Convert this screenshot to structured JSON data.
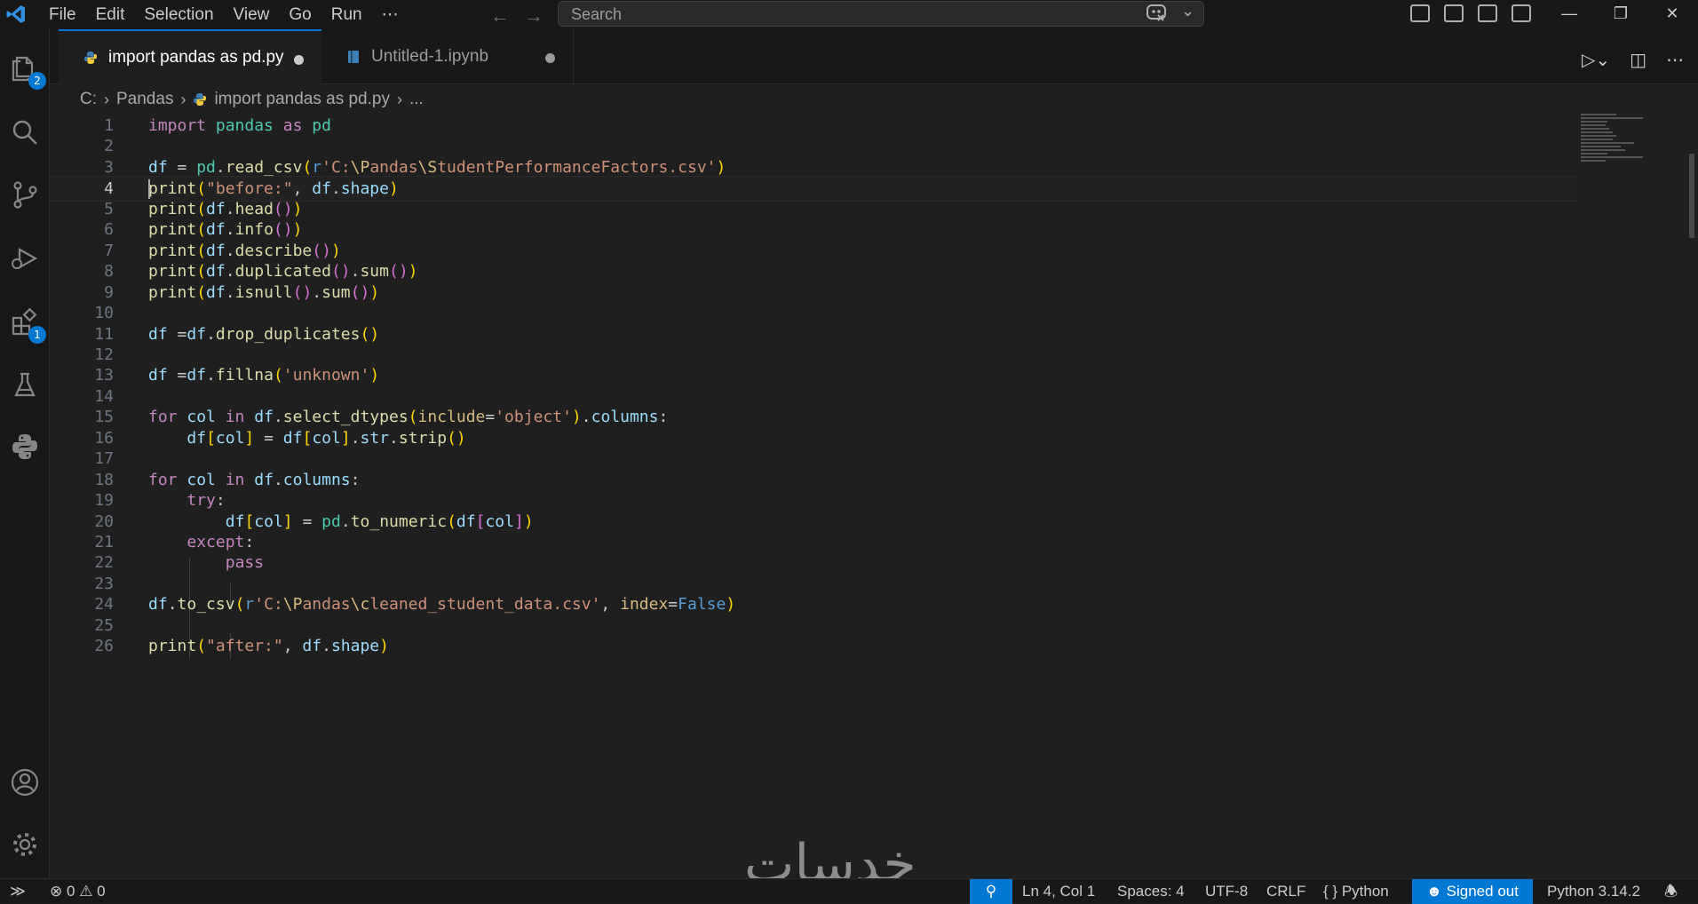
{
  "menu": [
    "File",
    "Edit",
    "Selection",
    "View",
    "Go",
    "Run",
    "⋯"
  ],
  "search": {
    "placeholder": "Search"
  },
  "activity_badges": {
    "explorer": "2",
    "extensions": "1"
  },
  "tabs": [
    {
      "label": "import pandas as pd.py",
      "dirty": true,
      "active": true
    },
    {
      "label": "Untitled-1.ipynb",
      "dirty": true,
      "active": false
    }
  ],
  "breadcrumb": [
    "C:",
    "Pandas",
    "import pandas as pd.py",
    "..."
  ],
  "editor": {
    "current_line": 4,
    "line_numbers": [
      "1",
      "2",
      "3",
      "4",
      "5",
      "6",
      "7",
      "8",
      "9",
      "10",
      "11",
      "12",
      "13",
      "14",
      "15",
      "16",
      "17",
      "18",
      "19",
      "20",
      "21",
      "22",
      "23",
      "24",
      "25",
      "26"
    ],
    "lines": [
      "import pandas as pd",
      "",
      "df = pd.read_csv(r'C:\\Pandas\\StudentPerformanceFactors.csv')",
      "print(\"before:\", df.shape)",
      "print(df.head())",
      "print(df.info())",
      "print(df.describe())",
      "print(df.duplicated().sum())",
      "print(df.isnull().sum())",
      "",
      "df =df.drop_duplicates()",
      "",
      "df =df.fillna('unknown')",
      "",
      "for col in df.select_dtypes(include='object').columns:",
      "    df[col] = df[col].str.strip()",
      "",
      "for col in df.columns:",
      "    try:",
      "        df[col] = pd.to_numeric(df[col])",
      "    except:",
      "        pass",
      "",
      "df.to_csv(r'C:\\Pandas\\cleaned_student_data.csv', index=False)",
      "",
      "print(\"after:\", df.shape)"
    ]
  },
  "statusbar": {
    "errors": "0",
    "warnings": "0",
    "position": "Ln 4, Col 1",
    "spaces": "Spaces: 4",
    "encoding": "UTF-8",
    "eol": "CRLF",
    "language": "Python",
    "signed": "Signed out",
    "interpreter": "Python 3.14.2"
  },
  "watermark": "خدسات",
  "colors": {
    "accent": "#0078d4",
    "background": "#1f1f1f",
    "chrome": "#181818"
  }
}
